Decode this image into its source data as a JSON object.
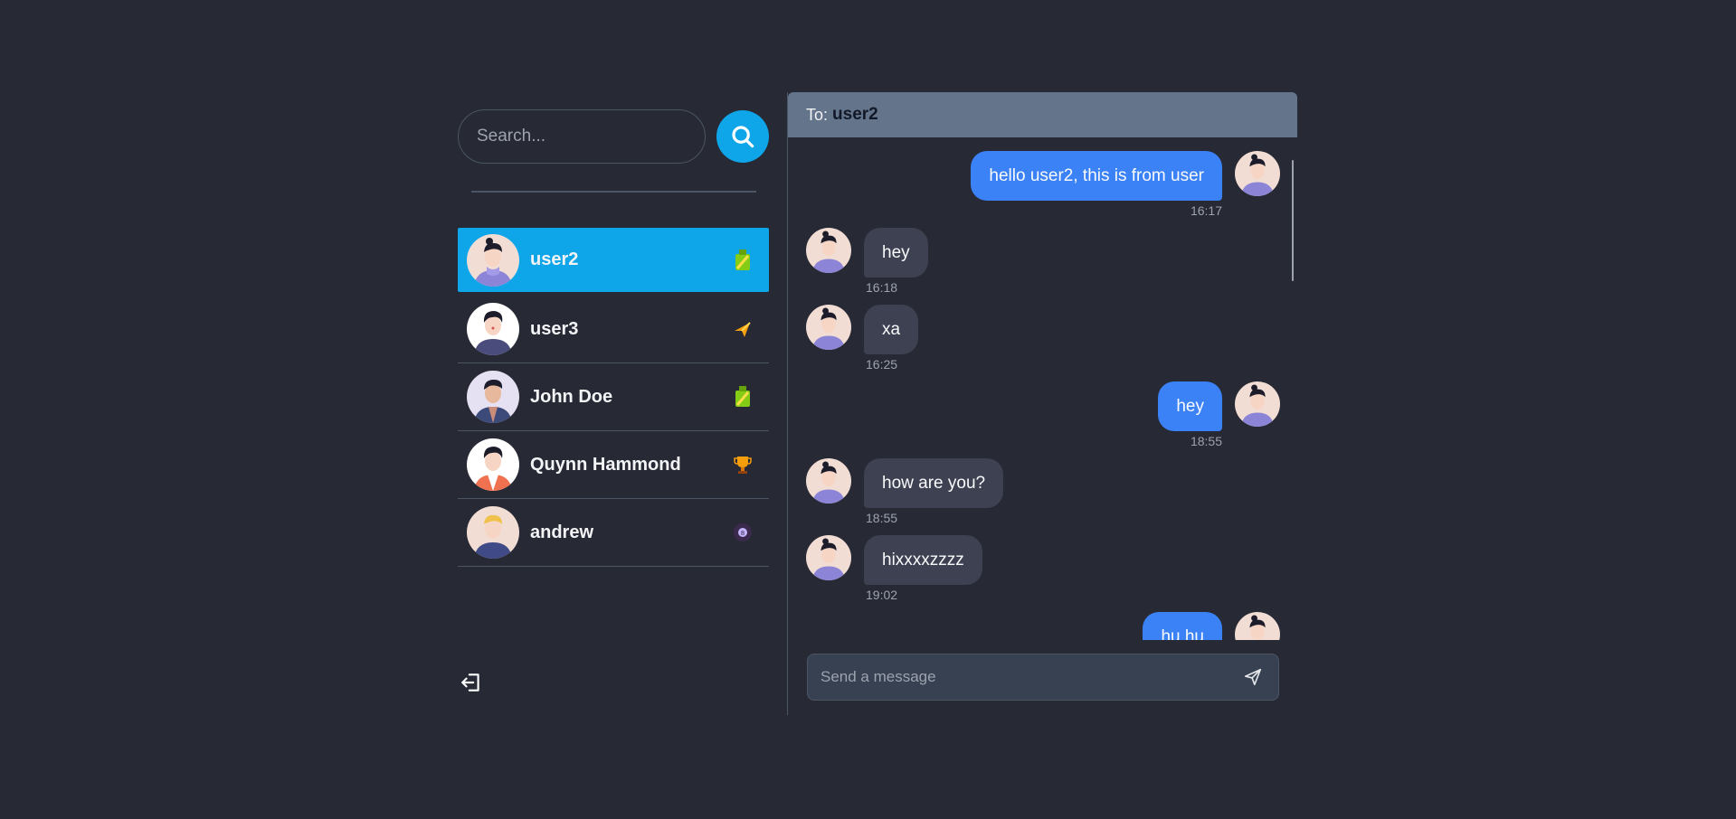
{
  "search": {
    "placeholder": "Search..."
  },
  "contacts": [
    {
      "name": "user2",
      "active": true,
      "badge": "green-bottle-icon"
    },
    {
      "name": "user3",
      "active": false,
      "badge": "plane-icon"
    },
    {
      "name": "John Doe",
      "active": false,
      "badge": "green-bottle-icon"
    },
    {
      "name": "Quynn Hammond",
      "active": false,
      "badge": "trophy-icon"
    },
    {
      "name": "andrew",
      "active": false,
      "badge": "eight-ball-icon"
    }
  ],
  "chat": {
    "to_label": "To:",
    "recipient": "user2",
    "messages": [
      {
        "direction": "out",
        "text": "hello user2, this is from user",
        "time": "16:17"
      },
      {
        "direction": "in",
        "text": "hey",
        "time": "16:18"
      },
      {
        "direction": "in",
        "text": "xa",
        "time": "16:25"
      },
      {
        "direction": "out",
        "text": "hey",
        "time": "18:55"
      },
      {
        "direction": "in",
        "text": "how are you?",
        "time": "18:55"
      },
      {
        "direction": "in",
        "text": "hixxxxzzzz",
        "time": "19:02"
      },
      {
        "direction": "out",
        "text": "hu hu",
        "time": ""
      }
    ],
    "composer_placeholder": "Send a message"
  },
  "colors": {
    "background": "#272935",
    "accent": "#0ea5e9",
    "outgoing_bubble": "#3b82f6",
    "incoming_bubble": "#3d4151",
    "header": "#64748b"
  }
}
